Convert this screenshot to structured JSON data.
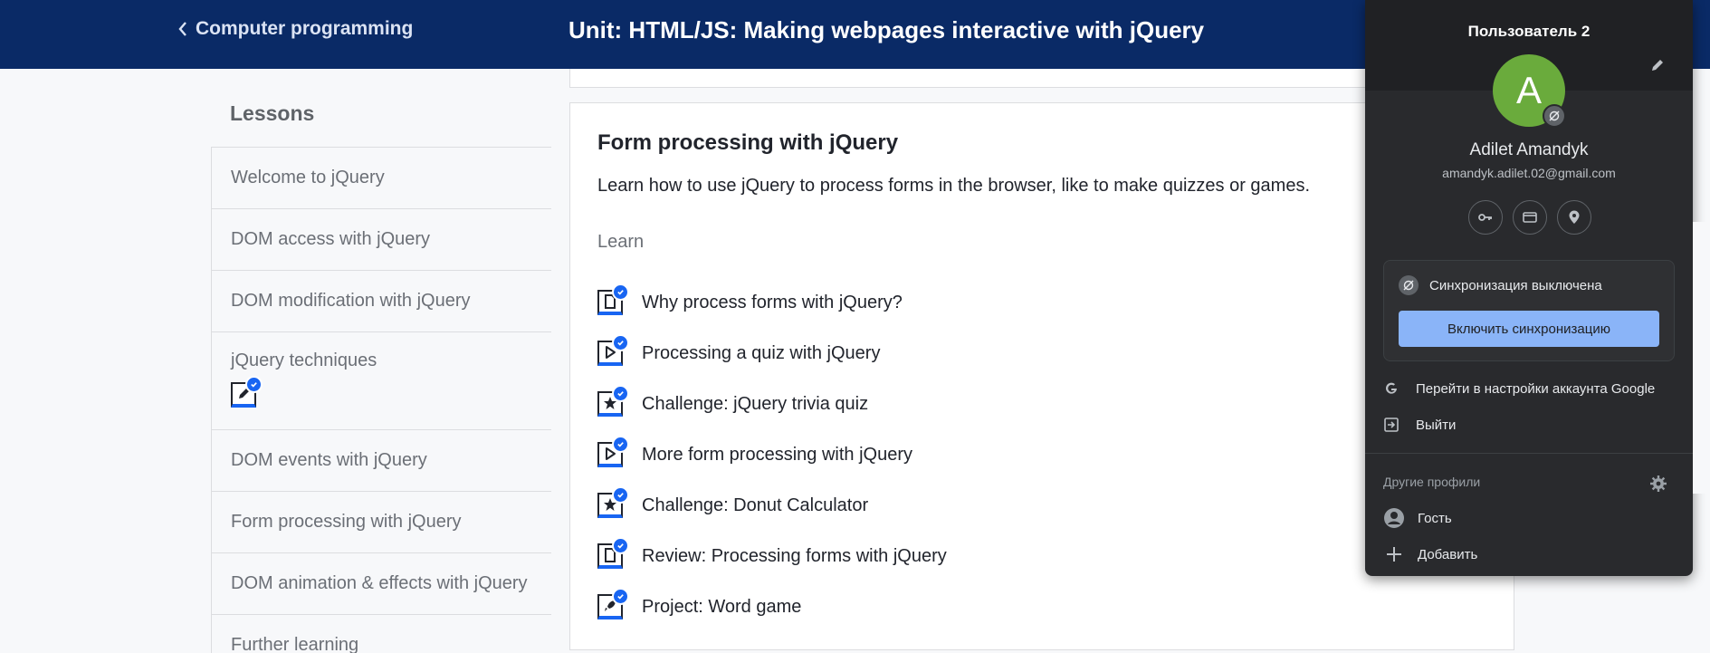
{
  "header": {
    "back_label": "Computer programming",
    "unit_title": "Unit: HTML/JS: Making webpages interactive with jQuery"
  },
  "sidebar": {
    "heading": "Lessons",
    "items": [
      {
        "label": "Welcome to jQuery"
      },
      {
        "label": "DOM access with jQuery"
      },
      {
        "label": "DOM modification with jQuery"
      },
      {
        "label": "jQuery techniques"
      },
      {
        "label": "DOM events with jQuery"
      },
      {
        "label": "Form processing with jQuery"
      },
      {
        "label": "DOM animation & effects with jQuery"
      },
      {
        "label": "Further learning"
      }
    ]
  },
  "main": {
    "title": "Form processing with jQuery",
    "description": "Learn how to use jQuery to process forms in the browser, like to make quizzes or games.",
    "learn_label": "Learn",
    "items": [
      {
        "label": "Why process forms with jQuery?",
        "icon": "article-icon"
      },
      {
        "label": "Processing a quiz with jQuery",
        "icon": "video-icon"
      },
      {
        "label": "Challenge: jQuery trivia quiz",
        "icon": "challenge-icon"
      },
      {
        "label": "More form processing with jQuery",
        "icon": "video-icon"
      },
      {
        "label": "Challenge: Donut Calculator",
        "icon": "challenge-icon"
      },
      {
        "label": "Review: Processing forms with jQuery",
        "icon": "article-icon"
      },
      {
        "label": "Project: Word game",
        "icon": "project-icon"
      }
    ]
  },
  "profile": {
    "profile_label": "Пользователь 2",
    "avatar_letter": "A",
    "name": "Adilet Amandyk",
    "email": "amandyk.adilet.02@gmail.com",
    "sync_status": "Синхронизация выключена",
    "sync_button": "Включить синхронизацию",
    "manage_account": "Перейти в настройки аккаунта Google",
    "sign_out": "Выйти",
    "other_profiles": "Другие профили",
    "guest": "Гость",
    "add": "Добавить"
  },
  "colors": {
    "header_bg": "#0a2a66",
    "accent_blue": "#1865f2",
    "avatar_green": "#6aab3c",
    "sync_button_bg": "#8ab4f8",
    "dropdown_bg": "#292a2d"
  }
}
